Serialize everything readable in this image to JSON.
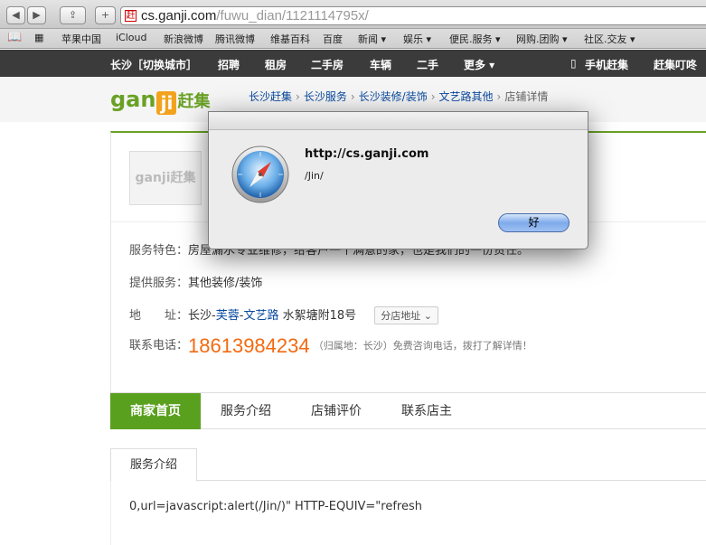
{
  "browser": {
    "url_host": "cs.ganji.com",
    "url_path": "/fuwu_dian/1121114795x/",
    "favicon": "赶",
    "bookmarks": [
      "苹果中国",
      "iCloud",
      "新浪微博",
      "腾讯微博",
      "维基百科",
      "百度",
      "新闻 ▾",
      "娱乐 ▾",
      "便民.服务 ▾",
      "网购.团购 ▾",
      "社区.交友 ▾"
    ]
  },
  "sitenav": {
    "city": "长沙［切换城市］",
    "items": [
      "招聘",
      "租房",
      "二手房",
      "车辆",
      "二手",
      "更多 ▾"
    ],
    "mobile": "手机赶集",
    "dingdong": "赶集叮咚"
  },
  "header": {
    "logo_text": "gan",
    "logo_square": "ji",
    "logo_cn": "赶集",
    "breadcrumb": [
      "长沙赶集",
      "长沙服务",
      "长沙装修/装饰",
      "文艺路其他"
    ],
    "breadcrumb_current": "店铺详情",
    "breadcrumb_sep": "›"
  },
  "shop": {
    "image_text": "ganji赶集",
    "feature_label": "服务特色：",
    "feature_value": "房屋漏水专业维修，给客户一个满意的家，也是我们的一份责任。",
    "service_label": "提供服务：",
    "service_value": "其他装修/装饰",
    "address_label": "地　　址：",
    "address_city": "长沙-",
    "address_district": "芙蓉",
    "address_dash": "-",
    "address_road": "文艺路",
    "address_detail": " 水絮塘附18号",
    "branch_button": "分店地址 ⌄",
    "phone_label": "联系电话：",
    "phone": "18613984234",
    "phone_note": "（归属地：长沙）免费咨询电话，拨打了解详情！"
  },
  "tabs": [
    "商家首页",
    "服务介绍",
    "店铺评价",
    "联系店主"
  ],
  "intro": {
    "tab": "服务介绍",
    "text": "0,url=javascript:alert(/Jin/)\" HTTP-EQUIV=\"refresh"
  },
  "dialog": {
    "title": "http://cs.ganji.com",
    "message": "/Jin/",
    "ok": "好"
  }
}
